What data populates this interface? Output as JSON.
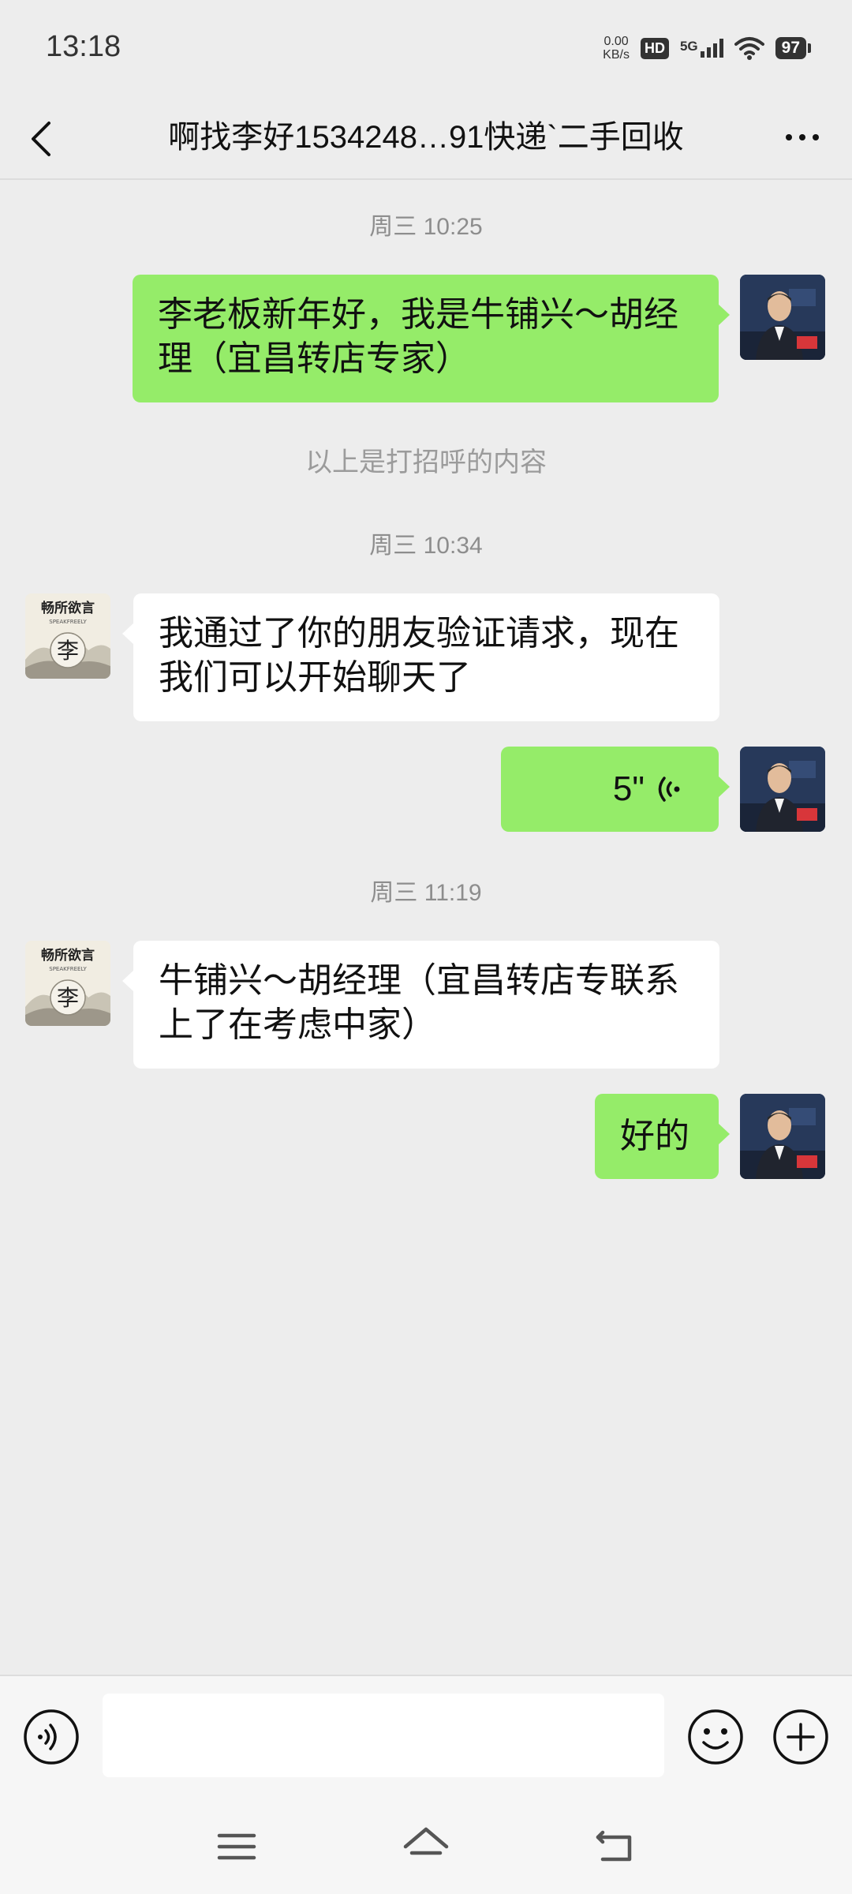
{
  "status_bar": {
    "time": "13:18",
    "net_speed_value": "0.00",
    "net_speed_unit": "KB/s",
    "hd_label": "HD",
    "network_label": "5G",
    "battery": "97"
  },
  "header": {
    "title": "啊找李好1534248…91快递`二手回收",
    "back_icon": "chevron-left-icon",
    "more_icon": "more-dots-icon"
  },
  "messages": [
    {
      "type": "timestamp",
      "text": "周三 10:25"
    },
    {
      "type": "text",
      "sender": "self",
      "text": "李老板新年好，我是牛铺兴～胡经理（宜昌转店专家）"
    },
    {
      "type": "system",
      "text": "以上是打招呼的内容"
    },
    {
      "type": "timestamp",
      "text": "周三 10:34"
    },
    {
      "type": "text",
      "sender": "other",
      "text": "我通过了你的朋友验证请求，现在我们可以开始聊天了"
    },
    {
      "type": "voice",
      "sender": "self",
      "duration": "5\""
    },
    {
      "type": "timestamp",
      "text": "周三 11:19"
    },
    {
      "type": "text",
      "sender": "other",
      "text": "牛铺兴～胡经理（宜昌转店专联系上了在考虑中家）"
    },
    {
      "type": "text",
      "sender": "self",
      "text": "好的"
    }
  ],
  "other_avatar": {
    "calligraphy": "畅所欲言",
    "subtitle": "SPEAKFREELY",
    "char": "李"
  },
  "input_bar": {
    "value": "",
    "voice_icon": "voice-input-icon",
    "emoji_icon": "emoji-icon",
    "plus_icon": "plus-icon"
  },
  "nav_bar": {
    "icons": [
      "menu-icon",
      "home-icon",
      "back-icon"
    ]
  },
  "colors": {
    "background": "#ededed",
    "bubble_self": "#95ec69",
    "bubble_other": "#ffffff",
    "timestamp": "#8d8d8d"
  }
}
